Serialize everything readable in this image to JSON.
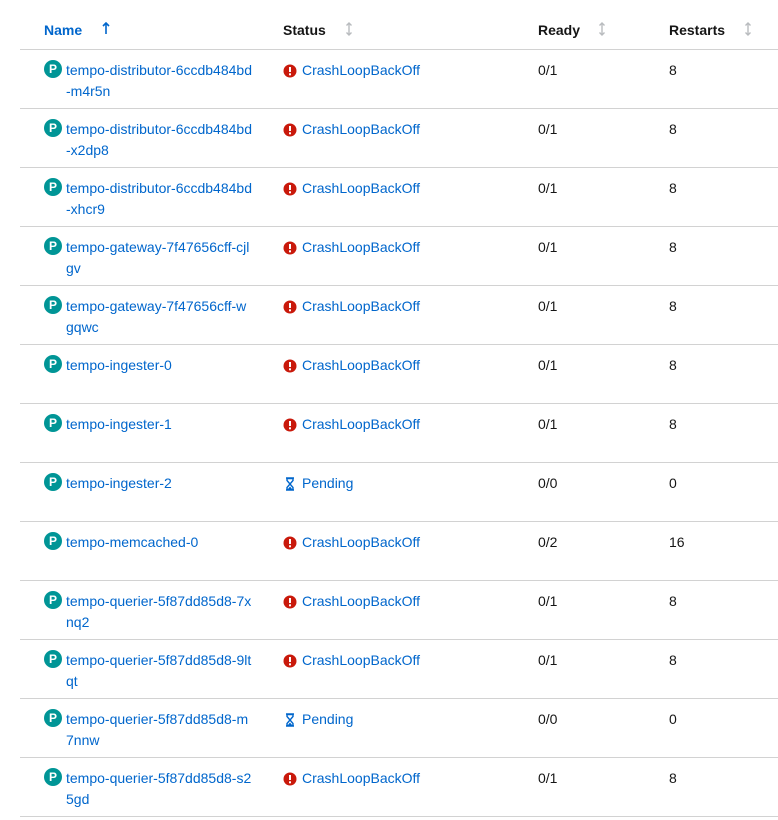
{
  "table": {
    "headers": {
      "name": "Name",
      "status": "Status",
      "ready": "Ready",
      "restarts": "Restarts"
    },
    "badge_letter": "P",
    "colors": {
      "link": "#0066cc",
      "badge": "#009596",
      "error": "#c9190b",
      "pending": "#0066cc",
      "border": "#d2d2d2"
    },
    "rows": [
      {
        "name": "tempo-distributor-6ccdb484bd-m4r5n",
        "status": "CrashLoopBackOff",
        "status_kind": "error",
        "ready": "0/1",
        "restarts": "8"
      },
      {
        "name": "tempo-distributor-6ccdb484bd-x2dp8",
        "status": "CrashLoopBackOff",
        "status_kind": "error",
        "ready": "0/1",
        "restarts": "8"
      },
      {
        "name": "tempo-distributor-6ccdb484bd-xhcr9",
        "status": "CrashLoopBackOff",
        "status_kind": "error",
        "ready": "0/1",
        "restarts": "8"
      },
      {
        "name": "tempo-gateway-7f47656cff-cjlgv",
        "status": "CrashLoopBackOff",
        "status_kind": "error",
        "ready": "0/1",
        "restarts": "8"
      },
      {
        "name": "tempo-gateway-7f47656cff-wgqwc",
        "status": "CrashLoopBackOff",
        "status_kind": "error",
        "ready": "0/1",
        "restarts": "8"
      },
      {
        "name": "tempo-ingester-0",
        "status": "CrashLoopBackOff",
        "status_kind": "error",
        "ready": "0/1",
        "restarts": "8"
      },
      {
        "name": "tempo-ingester-1",
        "status": "CrashLoopBackOff",
        "status_kind": "error",
        "ready": "0/1",
        "restarts": "8"
      },
      {
        "name": "tempo-ingester-2",
        "status": "Pending",
        "status_kind": "pending",
        "ready": "0/0",
        "restarts": "0"
      },
      {
        "name": "tempo-memcached-0",
        "status": "CrashLoopBackOff",
        "status_kind": "error",
        "ready": "0/2",
        "restarts": "16"
      },
      {
        "name": "tempo-querier-5f87dd85d8-7xnq2",
        "status": "CrashLoopBackOff",
        "status_kind": "error",
        "ready": "0/1",
        "restarts": "8"
      },
      {
        "name": "tempo-querier-5f87dd85d8-9ltqt",
        "status": "CrashLoopBackOff",
        "status_kind": "error",
        "ready": "0/1",
        "restarts": "8"
      },
      {
        "name": "tempo-querier-5f87dd85d8-m7nnw",
        "status": "Pending",
        "status_kind": "pending",
        "ready": "0/0",
        "restarts": "0"
      },
      {
        "name": "tempo-querier-5f87dd85d8-s25gd",
        "status": "CrashLoopBackOff",
        "status_kind": "error",
        "ready": "0/1",
        "restarts": "8"
      }
    ]
  }
}
